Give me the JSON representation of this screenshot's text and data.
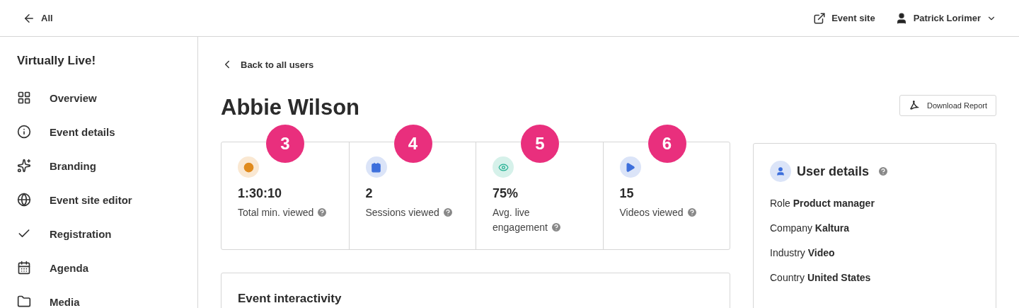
{
  "topbar": {
    "back_label": "All",
    "event_site": "Event site",
    "user_name": "Patrick Lorimer"
  },
  "sidebar": {
    "title": "Virtually Live!",
    "items": [
      {
        "label": "Overview"
      },
      {
        "label": "Event details"
      },
      {
        "label": "Branding"
      },
      {
        "label": "Event site editor"
      },
      {
        "label": "Registration"
      },
      {
        "label": "Agenda"
      },
      {
        "label": "Media"
      }
    ]
  },
  "back_link": "Back to all users",
  "user_title": "Abbie Wilson",
  "download_button": "Download Report",
  "stats": [
    {
      "kind": "time",
      "value": "1:30:10",
      "label": "Total min. viewed",
      "callout": "3"
    },
    {
      "kind": "sessions",
      "value": "2",
      "label": "Sessions viewed",
      "callout": "4"
    },
    {
      "kind": "engagement",
      "value": "75%",
      "label": "Avg. live engagement",
      "callout": "5"
    },
    {
      "kind": "videos",
      "value": "15",
      "label": "Videos viewed",
      "callout": "6"
    }
  ],
  "interactivity_title": "Event interactivity",
  "user_details": {
    "title": "User details",
    "rows": [
      "Role **Product manager**",
      "Company **Kaltura**",
      "Industry **Video**",
      "Country **United States**"
    ]
  }
}
